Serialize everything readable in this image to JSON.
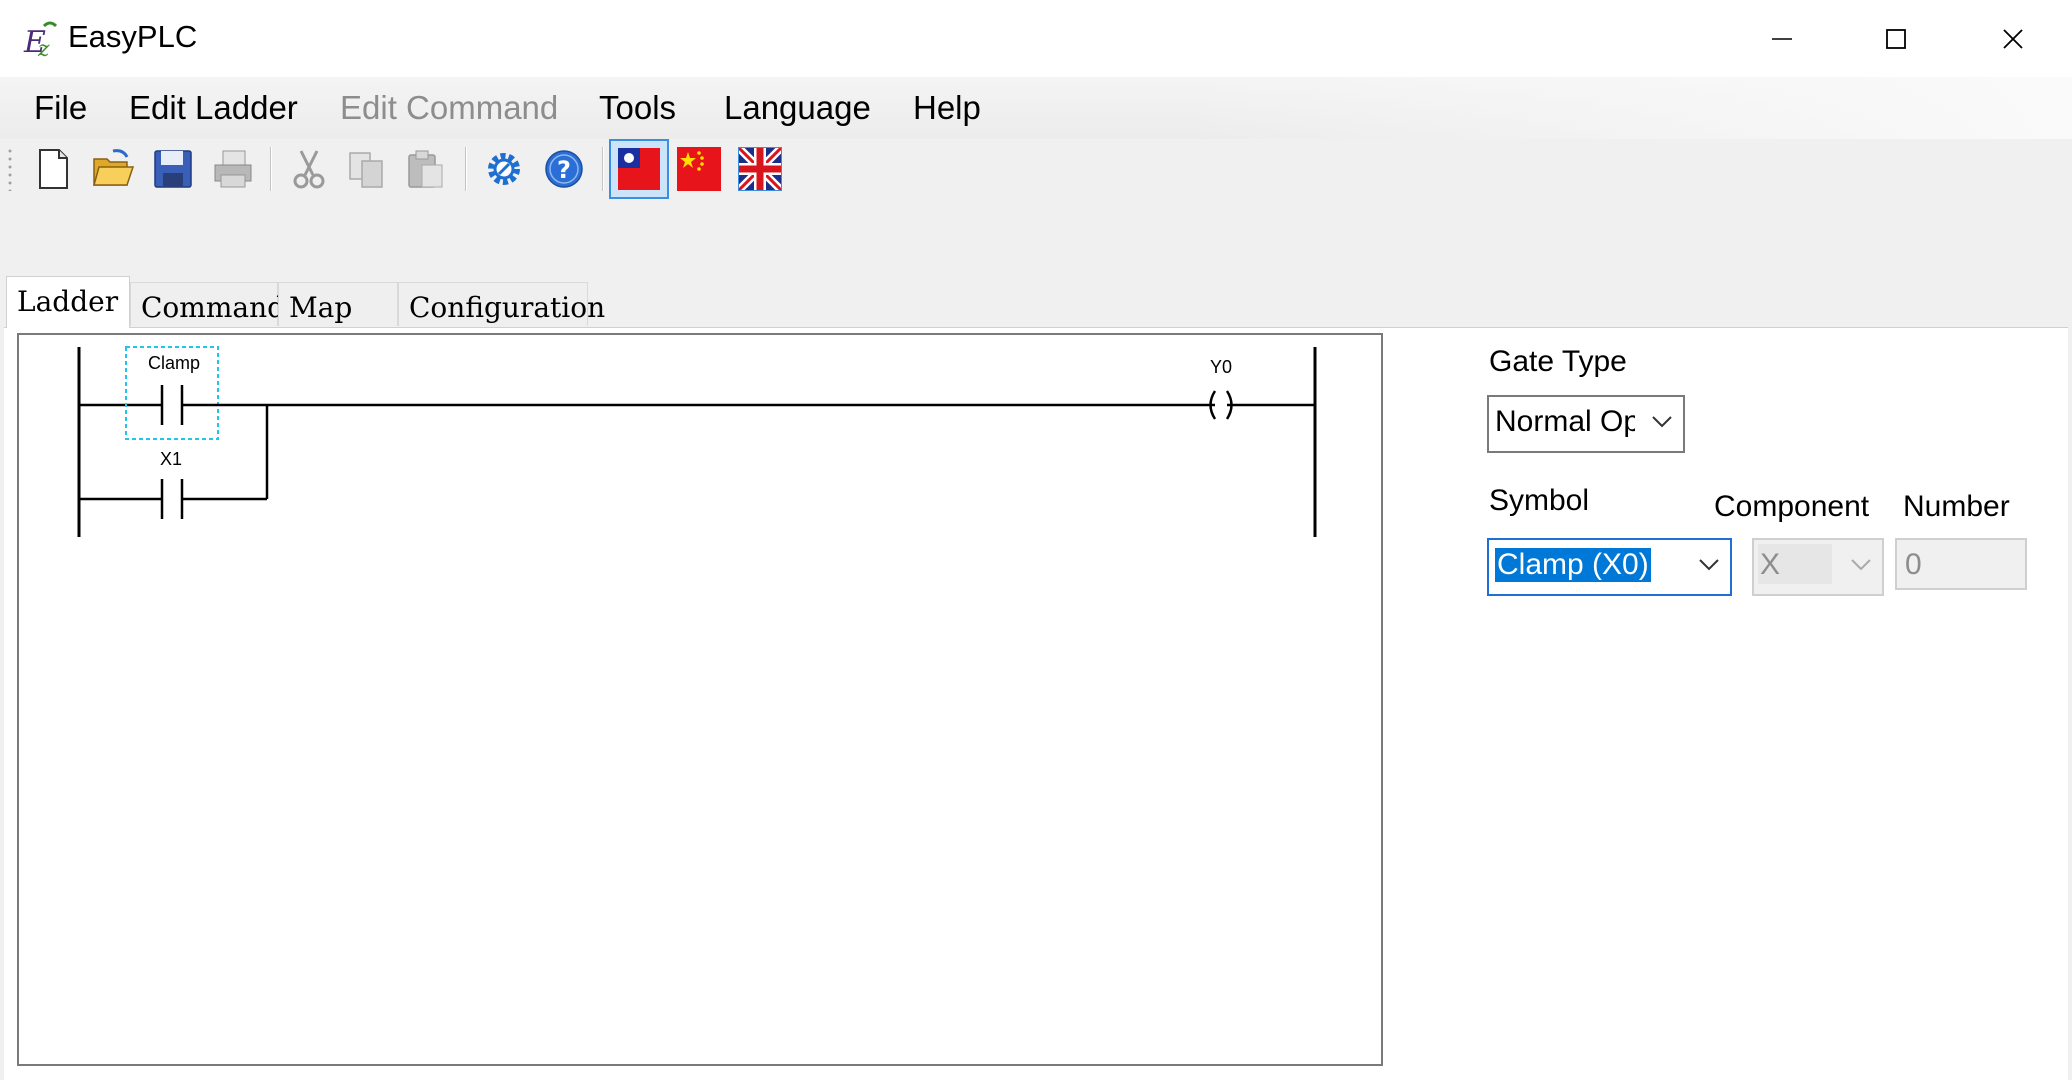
{
  "window": {
    "title": "EasyPLC"
  },
  "menu": {
    "file": "File",
    "edit_ladder": "Edit Ladder",
    "edit_command": "Edit Command",
    "tools": "Tools",
    "language": "Language",
    "help": "Help"
  },
  "toolbar": {
    "icons": [
      "new-file-icon",
      "open-folder-icon",
      "save-icon",
      "print-icon",
      "cut-icon",
      "copy-icon",
      "paste-icon",
      "settings-gear-icon",
      "help-icon",
      "flag-taiwan-icon",
      "flag-china-icon",
      "flag-uk-icon"
    ],
    "selected_language": "flag-taiwan-icon"
  },
  "tabs": {
    "ladder": "Ladder",
    "command": "Command",
    "map": "Map",
    "configuration": "Configuration",
    "active": "Ladder"
  },
  "ladder": {
    "contacts": [
      {
        "label": "Clamp",
        "selected": true
      },
      {
        "label": "X1",
        "selected": false
      }
    ],
    "coil": {
      "label": "Y0",
      "symbol": "( )"
    }
  },
  "panel": {
    "gate_type_label": "Gate Type",
    "gate_type_value": "Normal Op",
    "symbol_label": "Symbol",
    "symbol_value": "Clamp (X0)",
    "component_label": "Component",
    "component_value": "X",
    "number_label": "Number",
    "number_value": "0"
  },
  "colors": {
    "selection_dash": "#22c5e8",
    "focus_blue": "#0078d7",
    "disabled_text": "#8d8d8d"
  }
}
